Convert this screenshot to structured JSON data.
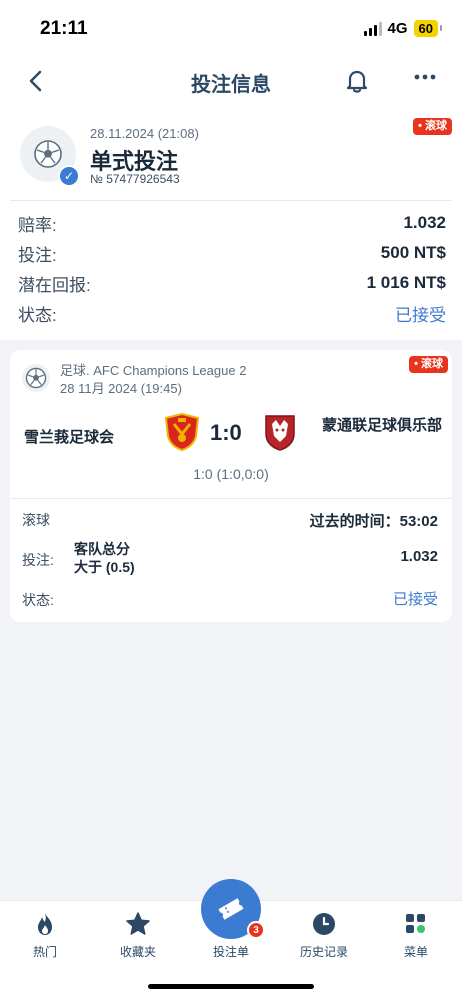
{
  "status_bar": {
    "time": "21:11",
    "network": "4G",
    "battery": "60"
  },
  "nav": {
    "title": "投注信息",
    "back_icon": "chevron-left-icon",
    "bell_icon": "bell-icon",
    "more_icon": "more-icon"
  },
  "bet": {
    "date": "28.11.2024 (21:08)",
    "type": "单式投注",
    "number": "№ 57477926543",
    "live_badge": "• 滚球"
  },
  "summary": [
    {
      "label": "赔率:",
      "value": "1.032",
      "accepted": false
    },
    {
      "label": "投注:",
      "value": "500 NT$",
      "accepted": false
    },
    {
      "label": "潜在回报:",
      "value": "1 016 NT$",
      "accepted": false
    },
    {
      "label": "状态:",
      "value": "已接受",
      "accepted": true
    }
  ],
  "event": {
    "live_badge": "• 滚球",
    "league": "足球. AFC Champions League 2",
    "date": "28 11月 2024 (19:45)",
    "home_team": "雪兰莪足球会",
    "away_team": "蒙通联足球俱乐部",
    "score": "1:0",
    "score_detail": "1:0 (1:0,0:0)",
    "live_label": "滚球",
    "elapsed": "过去的时间：53:02",
    "bet_label": "投注:",
    "bet_name_line1": "客队总分",
    "bet_name_line2": "大于 (0.5)",
    "bet_odds": "1.032",
    "status_label": "状态:",
    "status_value": "已接受"
  },
  "tabbar": {
    "items": [
      {
        "label": "热门",
        "icon": "flame-icon"
      },
      {
        "label": "收藏夹",
        "icon": "star-icon"
      },
      {
        "label": "投注单",
        "icon": "ticket-icon",
        "badge": "3"
      },
      {
        "label": "历史记录",
        "icon": "clock-icon"
      },
      {
        "label": "菜单",
        "icon": "menu-icon"
      }
    ]
  },
  "colors": {
    "accent": "#3b7bd1",
    "live": "#e8341c",
    "title": "#2b4866"
  }
}
